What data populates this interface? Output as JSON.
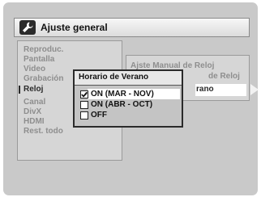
{
  "header": {
    "title": "Ajuste general",
    "icon": "wrench-icon"
  },
  "menu": {
    "items": [
      {
        "label": "Reproduc."
      },
      {
        "label": "Pantalla"
      },
      {
        "label": "Video"
      },
      {
        "label": "Grabación"
      },
      {
        "label": "Reloj"
      },
      {
        "label": "Canal"
      },
      {
        "label": "DivX"
      },
      {
        "label": "HDMI"
      },
      {
        "label": "Rest. todo"
      }
    ],
    "active": "Reloj"
  },
  "submenu": {
    "items": [
      {
        "label": "Ajste Manual de Reloj"
      },
      {
        "label": "de Reloj"
      },
      {
        "label": "rano"
      }
    ]
  },
  "popup": {
    "title": "Horario de Verano",
    "options": [
      {
        "label": "ON (MAR - NOV)",
        "checked": true
      },
      {
        "label": "ON (ABR - OCT)",
        "checked": false
      },
      {
        "label": "OFF",
        "checked": false
      }
    ]
  },
  "colors": {
    "panel": "#d6d6d6",
    "inactive_text": "#8e8e8e",
    "active_text": "#2a2a2a",
    "highlight": "#ffffff"
  }
}
